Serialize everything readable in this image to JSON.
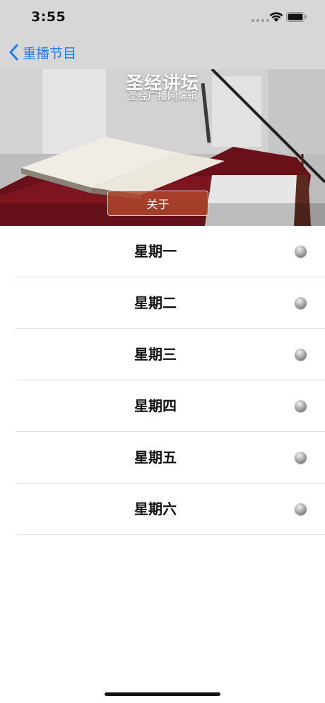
{
  "status_bar": {
    "time": "3:55"
  },
  "nav": {
    "back_label": "重播节目"
  },
  "banner": {
    "title": "圣经讲坛",
    "subtitle": "圣经广播网编辑",
    "about_button": "关于"
  },
  "days": [
    {
      "label": "星期一",
      "status_icon": "status-dot-icon"
    },
    {
      "label": "星期二",
      "status_icon": "status-dot-icon"
    },
    {
      "label": "星期三",
      "status_icon": "status-dot-icon"
    },
    {
      "label": "星期四",
      "status_icon": "status-dot-icon"
    },
    {
      "label": "星期五",
      "status_icon": "status-dot-icon"
    },
    {
      "label": "星期六",
      "status_icon": "status-dot-icon"
    }
  ],
  "colors": {
    "nav_background": "#d7d7d7",
    "accent_blue": "#1d7cf2",
    "about_button": "#b0482c",
    "divider": "#e2e2e2"
  }
}
